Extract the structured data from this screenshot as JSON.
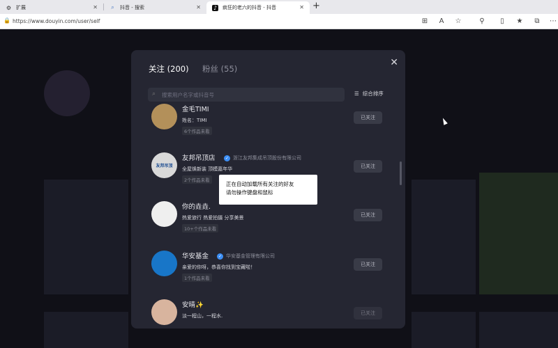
{
  "browser": {
    "tabs": [
      {
        "label": "扩展",
        "icon": "extensions-icon"
      },
      {
        "label": "抖音 - 搜索",
        "icon": "search-icon"
      },
      {
        "label": "疯狂的老六的抖音 - 抖音",
        "icon": "douyin-icon"
      }
    ],
    "new_tab_label": "+",
    "url": "https://www.douyin.com/user/self"
  },
  "modal": {
    "tabs": [
      {
        "label": "关注 (200)"
      },
      {
        "label": "粉丝 (55)"
      }
    ],
    "search_placeholder": "搜索用户名字或抖音号",
    "sort_label": "综合排序",
    "users": [
      {
        "name": "金毛TIMI",
        "bio": "姓名：TIMI",
        "count": "6个作品未看",
        "button": "已关注"
      },
      {
        "name": "友邦吊顶店",
        "verify": "浙江友邦集成吊顶股份有限公司",
        "bio": "全屋焕新装 顶模嘉年华",
        "count": "2个作品未看",
        "button": "已关注",
        "avatar_text": "友邦吊顶"
      },
      {
        "name": "你的垚垚.",
        "bio": "热爱旅行 热爱拍摄 分享美景",
        "count": "10+个作品未看",
        "button": "已关注"
      },
      {
        "name": "华安基金",
        "verify": "华安基金管理有限公司",
        "bio": "亲爱的你呀，恭喜你找到宝藏啦！",
        "count": "1个作品未看",
        "button": "已关注"
      },
      {
        "name": "安晴✨",
        "bio": "淡一程山，一程水.",
        "count": "",
        "button": "已关注"
      }
    ]
  },
  "toast": {
    "line1": "正在自动加载所有关注的好友",
    "line2": "请勿操作键盘和鼠标"
  },
  "colors": {
    "accent": "#fe2c55",
    "verify": "#3d8ff5",
    "modal_bg": "#252632"
  }
}
